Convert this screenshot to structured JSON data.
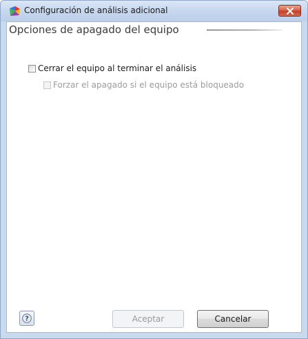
{
  "window": {
    "title": "Configuración de análisis adicional",
    "app_icon": "avg-logo-icon",
    "close_icon": "close-icon"
  },
  "section": {
    "title": "Opciones de apagado del equipo"
  },
  "options": [
    {
      "label": "Cerrar el equipo al terminar el análisis",
      "checked": false,
      "enabled": true
    },
    {
      "label": "Forzar el apagado si el equipo está bloqueado",
      "checked": false,
      "enabled": false
    }
  ],
  "footer": {
    "help_icon": "help-icon",
    "accept_label": "Aceptar",
    "accept_enabled": false,
    "cancel_label": "Cancelar"
  }
}
